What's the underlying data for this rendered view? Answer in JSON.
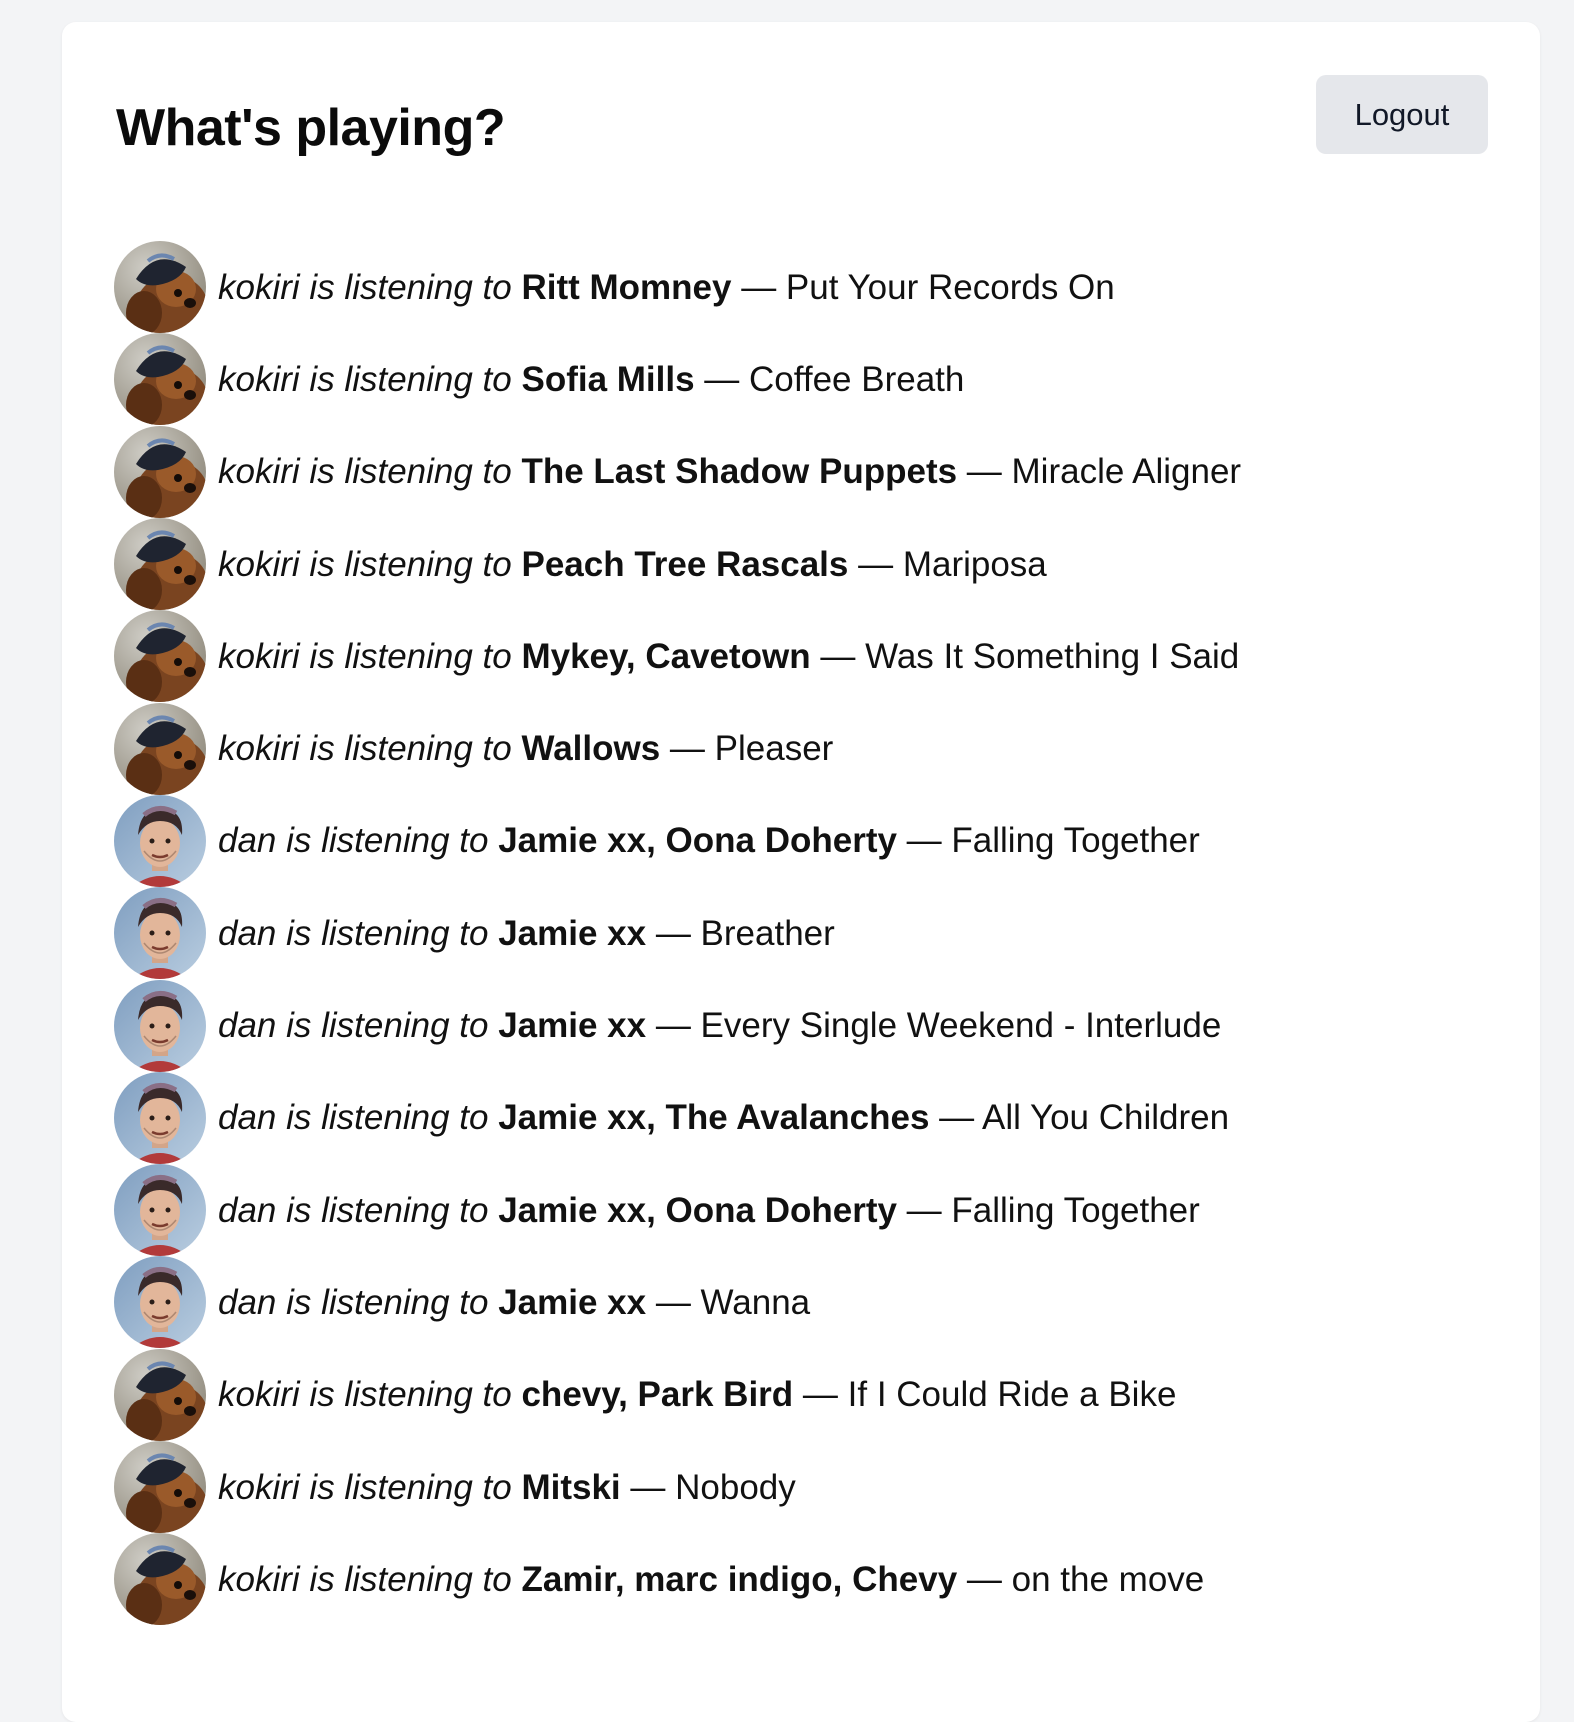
{
  "page": {
    "title": "What's playing?",
    "logout_label": "Logout"
  },
  "feed": [
    {
      "user": "kokiri",
      "verb": " is listening to ",
      "artist": "Ritt Momney",
      "sep": " — ",
      "track": "Put Your Records On"
    },
    {
      "user": "kokiri",
      "verb": " is listening to ",
      "artist": "Sofia Mills",
      "sep": " — ",
      "track": "Coffee Breath"
    },
    {
      "user": "kokiri",
      "verb": " is listening to ",
      "artist": "The Last Shadow Puppets",
      "sep": " — ",
      "track": "Miracle Aligner"
    },
    {
      "user": "kokiri",
      "verb": " is listening to ",
      "artist": "Peach Tree Rascals",
      "sep": " — ",
      "track": "Mariposa"
    },
    {
      "user": "kokiri",
      "verb": " is listening to ",
      "artist": "Mykey, Cavetown",
      "sep": " — ",
      "track": "Was It Something I Said"
    },
    {
      "user": "kokiri",
      "verb": " is listening to ",
      "artist": "Wallows",
      "sep": " — ",
      "track": "Pleaser"
    },
    {
      "user": "dan",
      "verb": " is listening to ",
      "artist": "Jamie xx, Oona Doherty",
      "sep": " — ",
      "track": "Falling Together"
    },
    {
      "user": "dan",
      "verb": " is listening to ",
      "artist": "Jamie xx",
      "sep": " — ",
      "track": "Breather"
    },
    {
      "user": "dan",
      "verb": " is listening to ",
      "artist": "Jamie xx",
      "sep": " — ",
      "track": "Every Single Weekend - Interlude"
    },
    {
      "user": "dan",
      "verb": " is listening to ",
      "artist": "Jamie xx, The Avalanches",
      "sep": " — ",
      "track": "All You Children"
    },
    {
      "user": "dan",
      "verb": " is listening to ",
      "artist": "Jamie xx, Oona Doherty",
      "sep": " — ",
      "track": "Falling Together"
    },
    {
      "user": "dan",
      "verb": " is listening to ",
      "artist": "Jamie xx",
      "sep": " — ",
      "track": "Wanna"
    },
    {
      "user": "kokiri",
      "verb": " is listening to ",
      "artist": "chevy, Park Bird",
      "sep": " — ",
      "track": "If I Could Ride a Bike"
    },
    {
      "user": "kokiri",
      "verb": " is listening to ",
      "artist": "Mitski",
      "sep": " — ",
      "track": "Nobody"
    },
    {
      "user": "kokiri",
      "verb": " is listening to ",
      "artist": "Zamir, marc indigo, Chevy",
      "sep": " — ",
      "track": "on the move"
    }
  ],
  "icons": {
    "kokiri_avatar": "dog-photo-avatar",
    "dan_avatar": "man-photo-avatar"
  },
  "colors": {
    "page_bg": "#f3f4f6",
    "card_bg": "#ffffff",
    "button_bg": "#e5e7eb"
  }
}
